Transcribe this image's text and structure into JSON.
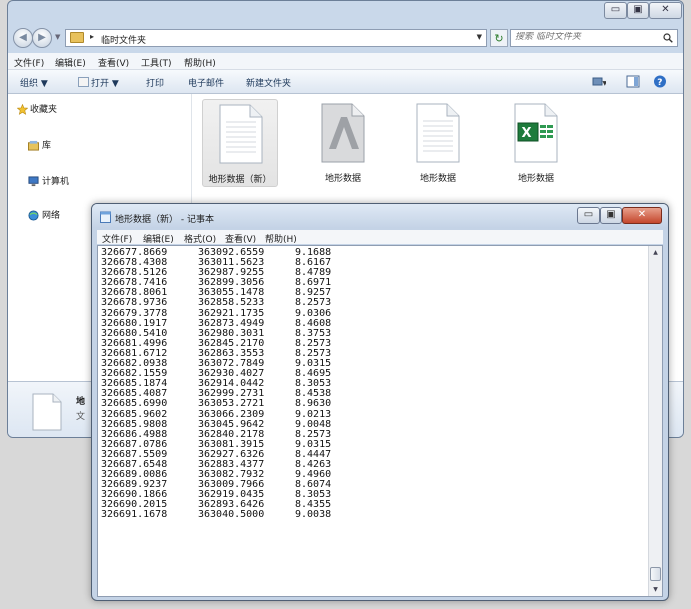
{
  "explorer": {
    "address": {
      "separator": "▸",
      "path": "临时文件夹"
    },
    "search": {
      "placeholder": "搜索 临时文件夹"
    },
    "menu": [
      "文件(F)",
      "编辑(E)",
      "查看(V)",
      "工具(T)",
      "帮助(H)"
    ],
    "toolbar": {
      "organize": "组织 ▼",
      "open": "打开 ▼",
      "print": "打印",
      "email": "电子邮件",
      "new_folder": "新建文件夹"
    },
    "sidebar": {
      "favorites": "收藏夹",
      "libraries": "库",
      "computer": "计算机",
      "network": "网络"
    },
    "files": [
      {
        "label": "地形数据（新）",
        "type": "text",
        "selected": true
      },
      {
        "label": "地形数据",
        "type": "autocad",
        "selected": false
      },
      {
        "label": "地形数据",
        "type": "text",
        "selected": false
      },
      {
        "label": "地形数据",
        "type": "excel",
        "selected": false
      }
    ],
    "details": {
      "name": "地",
      "type": "文"
    }
  },
  "notepad": {
    "title": "地形数据（新） - 记事本",
    "menu": [
      "文件(F)",
      "编辑(E)",
      "格式(O)",
      "查看(V)",
      "帮助(H)"
    ],
    "rows": [
      [
        "326677.8669",
        "363092.6559",
        "9.1688"
      ],
      [
        "326678.4308",
        "363011.5623",
        "8.6167"
      ],
      [
        "326678.5126",
        "362987.9255",
        "8.4789"
      ],
      [
        "326678.7416",
        "362899.3056",
        "8.6971"
      ],
      [
        "326678.8061",
        "363055.1478",
        "8.9257"
      ],
      [
        "326678.9736",
        "362858.5233",
        "8.2573"
      ],
      [
        "326679.3778",
        "362921.1735",
        "9.0306"
      ],
      [
        "326680.1917",
        "362873.4949",
        "8.4608"
      ],
      [
        "326680.5410",
        "362980.3031",
        "8.3753"
      ],
      [
        "326681.4996",
        "362845.2170",
        "8.2573"
      ],
      [
        "326681.6712",
        "362863.3553",
        "8.2573"
      ],
      [
        "326682.0938",
        "363072.7849",
        "9.0315"
      ],
      [
        "326682.1559",
        "362930.4027",
        "8.4695"
      ],
      [
        "326685.1874",
        "362914.0442",
        "8.3053"
      ],
      [
        "326685.4087",
        "362999.2731",
        "8.4538"
      ],
      [
        "326685.6990",
        "363053.2721",
        "8.9630"
      ],
      [
        "326685.9602",
        "363066.2309",
        "9.0213"
      ],
      [
        "326685.9808",
        "363045.9642",
        "9.0048"
      ],
      [
        "326686.4988",
        "362840.2178",
        "8.2573"
      ],
      [
        "326687.0786",
        "363081.3915",
        "9.0315"
      ],
      [
        "326687.5509",
        "362927.6326",
        "8.4447"
      ],
      [
        "326687.6548",
        "362883.4377",
        "8.4263"
      ],
      [
        "326689.0086",
        "363082.7932",
        "9.4960"
      ],
      [
        "326689.9237",
        "363009.7966",
        "8.6074"
      ],
      [
        "326690.1866",
        "362919.0435",
        "8.3053"
      ],
      [
        "326690.2015",
        "362893.6426",
        "8.4355"
      ],
      [
        "326691.1678",
        "363040.5000",
        "9.0038"
      ]
    ]
  }
}
